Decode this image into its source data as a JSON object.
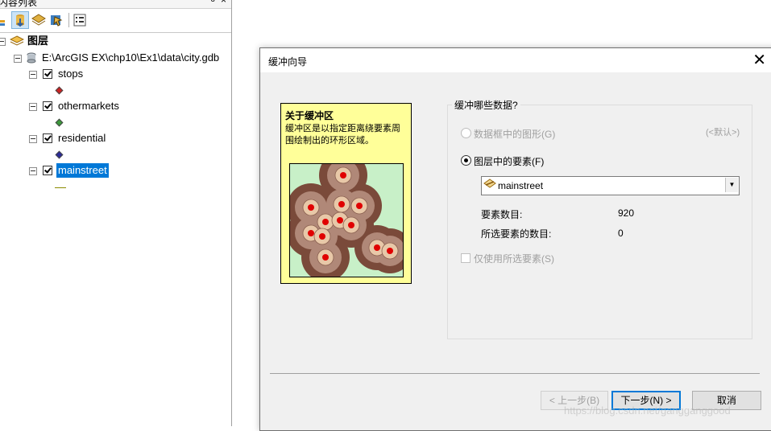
{
  "toc": {
    "title": "内容列表",
    "pin_glyph": "ᵾ",
    "close_glyph": "×",
    "root_label": "图层",
    "gdb_path": "E:\\ArcGIS EX\\chp10\\Ex1\\data\\city.gdb",
    "layers": [
      {
        "name": "stops",
        "symbol_color": "#cc2222"
      },
      {
        "name": "othermarkets",
        "symbol_color": "#3c9a3c"
      },
      {
        "name": "residential",
        "symbol_color": "#2b2b99"
      },
      {
        "name": "mainstreet",
        "symbol_color": "#8a8a00"
      }
    ]
  },
  "dialog": {
    "title": "缓冲向导",
    "close_glyph": "✕",
    "info_title": "关于缓冲区",
    "info_text": "缓冲区是以指定距离绕要素周围绘制出的环形区域。",
    "group_label": "缓冲哪些数据?",
    "option_graphics": "数据框中的图形(G)",
    "default_hint": "(<默认>)",
    "option_layer": "图层中的要素(F)",
    "selected_layer": "mainstreet",
    "feature_count_label": "要素数目:",
    "feature_count": "920",
    "selected_count_label": "所选要素的数目:",
    "selected_count": "0",
    "use_selected_label": "仅使用所选要素(S)",
    "btn_back": "< 上一步(B)",
    "btn_next": "下一步(N) >",
    "btn_cancel": "取消"
  },
  "watermark": "https://blog.csdn.net/gangganggood"
}
